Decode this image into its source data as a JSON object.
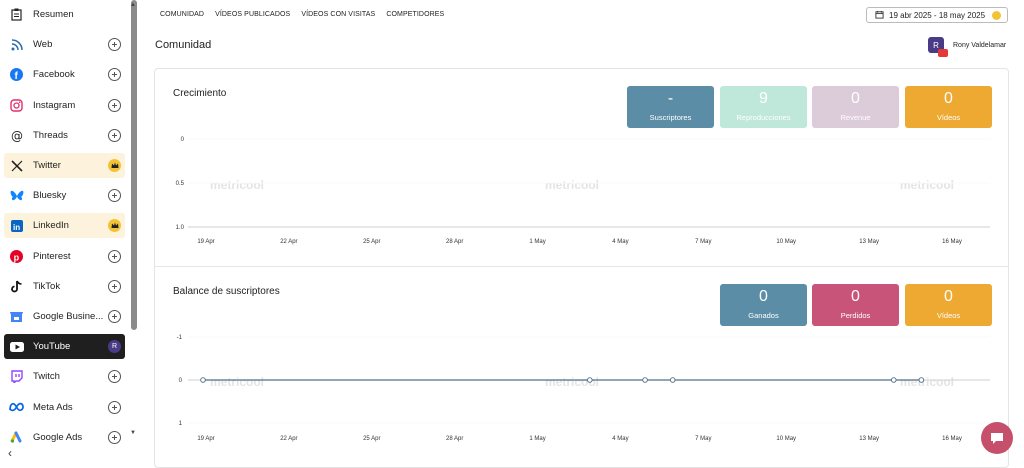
{
  "sidebar": {
    "items": [
      {
        "label": "Resumen",
        "icon": "clipboard-icon",
        "state": "none"
      },
      {
        "label": "Web",
        "icon": "rss-icon",
        "state": "plus"
      },
      {
        "label": "Facebook",
        "icon": "facebook-icon",
        "state": "plus"
      },
      {
        "label": "Instagram",
        "icon": "instagram-icon",
        "state": "plus"
      },
      {
        "label": "Threads",
        "icon": "threads-icon",
        "state": "plus"
      },
      {
        "label": "Twitter",
        "icon": "x-twitter-icon",
        "state": "premium"
      },
      {
        "label": "Bluesky",
        "icon": "bluesky-icon",
        "state": "plus"
      },
      {
        "label": "LinkedIn",
        "icon": "linkedin-icon",
        "state": "premium"
      },
      {
        "label": "Pinterest",
        "icon": "pinterest-icon",
        "state": "plus"
      },
      {
        "label": "TikTok",
        "icon": "tiktok-icon",
        "state": "plus"
      },
      {
        "label": "Google Busine...",
        "icon": "google-business-icon",
        "state": "plus"
      },
      {
        "label": "YouTube",
        "icon": "youtube-icon",
        "state": "avatar",
        "avatar": "R"
      },
      {
        "label": "Twitch",
        "icon": "twitch-icon",
        "state": "plus"
      },
      {
        "label": "Meta Ads",
        "icon": "meta-icon",
        "state": "plus"
      },
      {
        "label": "Google Ads",
        "icon": "google-ads-icon",
        "state": "plus"
      }
    ],
    "collapse": "‹"
  },
  "topnav": [
    "COMUNIDAD",
    "VÍDEOS PUBLICADOS",
    "VÍDEOS CON VISITAS",
    "COMPETIDORES"
  ],
  "date_range": "19 abr 2025 - 18 may 2025",
  "page_title": "Comunidad",
  "account": {
    "name": "Rony Valdelamar",
    "avatar": "R"
  },
  "watermark": "metricool",
  "growth": {
    "title": "Crecimiento",
    "kpis": [
      {
        "value": "-",
        "label": "Suscriptores",
        "color": "#5b8ea6"
      },
      {
        "value": "9",
        "label": "Reproducciones",
        "color": "#bfe8da"
      },
      {
        "value": "0",
        "label": "Revenue",
        "color": "#dccbd8"
      },
      {
        "value": "0",
        "label": "Vídeos",
        "color": "#eda932"
      }
    ],
    "yticks": [
      "1.0",
      "0.5",
      "0"
    ],
    "xticks": [
      "19 Apr",
      "22 Apr",
      "25 Apr",
      "28 Apr",
      "1 May",
      "4 May",
      "7 May",
      "10 May",
      "13 May",
      "16 May"
    ]
  },
  "balance": {
    "title": "Balance de suscriptores",
    "kpis": [
      {
        "value": "0",
        "label": "Ganados",
        "color": "#5b8ea6"
      },
      {
        "value": "0",
        "label": "Perdidos",
        "color": "#c9547a"
      },
      {
        "value": "0",
        "label": "Vídeos",
        "color": "#eda932"
      }
    ],
    "yticks": [
      "1",
      "0",
      "-1"
    ],
    "xticks": [
      "19 Apr",
      "22 Apr",
      "25 Apr",
      "28 Apr",
      "1 May",
      "4 May",
      "7 May",
      "10 May",
      "13 May",
      "16 May"
    ]
  },
  "chart_data": [
    {
      "type": "line",
      "title": "Crecimiento",
      "categories": [
        "19 Apr",
        "22 Apr",
        "25 Apr",
        "28 Apr",
        "1 May",
        "4 May",
        "7 May",
        "10 May",
        "13 May",
        "16 May"
      ],
      "ylim": [
        0,
        1
      ],
      "yticks": [
        0,
        0.5,
        1.0
      ],
      "series": []
    },
    {
      "type": "line",
      "title": "Balance de suscriptores",
      "categories": [
        "19 Apr",
        "22 Apr",
        "25 Apr",
        "28 Apr",
        "1 May",
        "4 May",
        "7 May",
        "10 May",
        "13 May",
        "16 May"
      ],
      "ylim": [
        -1,
        1
      ],
      "yticks": [
        -1,
        0,
        1
      ],
      "series": [
        {
          "values": [
            0,
            0,
            0,
            0,
            0,
            0,
            0,
            0,
            0,
            0,
            0,
            0,
            0,
            0,
            0,
            0,
            0,
            0,
            0,
            0,
            0,
            0,
            0,
            0,
            0,
            0,
            0,
            0,
            0
          ]
        }
      ],
      "marked_points": [
        "19 Apr",
        "3 May",
        "5 May",
        "6 May",
        "14 May",
        "15 May"
      ]
    }
  ]
}
